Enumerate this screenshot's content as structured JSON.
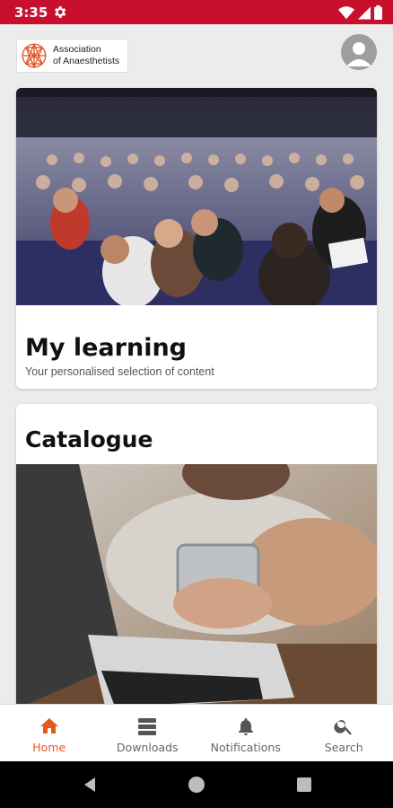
{
  "status_bar": {
    "time": "3:35"
  },
  "header": {
    "logo_line1": "Association",
    "logo_line2": "of Anaesthetists"
  },
  "cards": [
    {
      "title": "My learning",
      "subtitle": "Your personalised selection of content"
    },
    {
      "title": "Catalogue"
    }
  ],
  "bottom_nav": {
    "items": [
      {
        "label": "Home",
        "icon": "home-icon",
        "active": true
      },
      {
        "label": "Downloads",
        "icon": "downloads-icon",
        "active": false
      },
      {
        "label": "Notifications",
        "icon": "bell-icon",
        "active": false
      },
      {
        "label": "Search",
        "icon": "search-icon",
        "active": false
      }
    ]
  },
  "colors": {
    "brand_red": "#c8102e",
    "active_orange": "#e8571a"
  }
}
